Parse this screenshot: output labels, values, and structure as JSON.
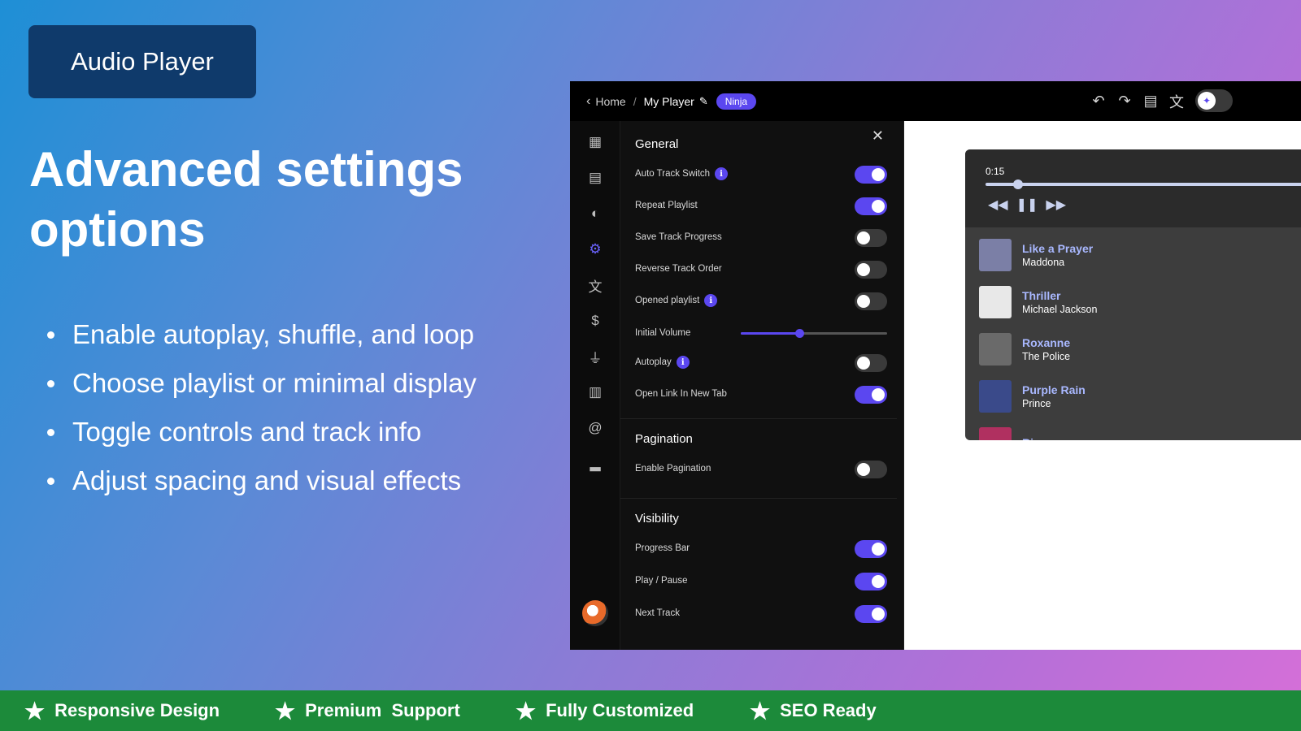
{
  "badge": "Audio Player",
  "headline": "Advanced settings options",
  "bullets": [
    "Enable autoplay, shuffle, and loop",
    "Choose playlist or minimal display",
    "Toggle controls and track info",
    "Adjust spacing and visual effects"
  ],
  "topbar": {
    "home": "Home",
    "separator": "/",
    "current": "My Player",
    "tag": "Ninja"
  },
  "icons": {
    "back": "chevron-left-icon",
    "undo": "undo-icon",
    "redo": "redo-icon",
    "paint": "paint-roller-icon",
    "translate": "translate-icon",
    "desktop": "desktop-icon",
    "ai": "sparkle-icon"
  },
  "rail": [
    "dashboard-icon",
    "table-icon",
    "palette-icon",
    "settings-icon",
    "translate-icon",
    "dollar-icon",
    "plug-icon",
    "newspaper-icon",
    "at-icon",
    "chart-icon"
  ],
  "settings": {
    "general_title": "General",
    "general": [
      {
        "label": "Auto Track Switch",
        "info": true,
        "on": true
      },
      {
        "label": "Repeat Playlist",
        "info": false,
        "on": true
      },
      {
        "label": "Save Track Progress",
        "info": false,
        "on": false
      },
      {
        "label": "Reverse Track Order",
        "info": false,
        "on": false
      },
      {
        "label": "Opened playlist",
        "info": true,
        "on": false
      }
    ],
    "volume_label": "Initial Volume",
    "volume_level": 0.4,
    "general_after": [
      {
        "label": "Autoplay",
        "info": true,
        "on": false
      },
      {
        "label": "Open Link In New Tab",
        "info": false,
        "on": true
      }
    ],
    "pagination_title": "Pagination",
    "pagination": [
      {
        "label": "Enable Pagination",
        "on": false
      }
    ],
    "visibility_title": "Visibility",
    "visibility": [
      {
        "label": "Progress Bar",
        "on": true
      },
      {
        "label": "Play / Pause",
        "on": true
      },
      {
        "label": "Next Track",
        "on": true
      }
    ]
  },
  "player": {
    "time": "0:15",
    "progress": 0.1,
    "tracks": [
      {
        "title": "Like a Prayer",
        "artist": "Maddona",
        "color": "#7b7fa6"
      },
      {
        "title": "Thriller",
        "artist": "Michael Jackson",
        "color": "#e8e8e8"
      },
      {
        "title": "Roxanne",
        "artist": "The Police",
        "color": "#6a6a6a"
      },
      {
        "title": "Purple Rain",
        "artist": "Prince",
        "color": "#3a4a8a"
      },
      {
        "title": "Rio",
        "artist": "",
        "color": "#b03060"
      }
    ]
  },
  "features": [
    "Responsive Design",
    "Premium  Support",
    "Fully Customized",
    "SEO Ready"
  ],
  "colors": {
    "accent": "#5b47f0",
    "strip": "#1c8a3a",
    "badge": "#0f3a6b"
  }
}
